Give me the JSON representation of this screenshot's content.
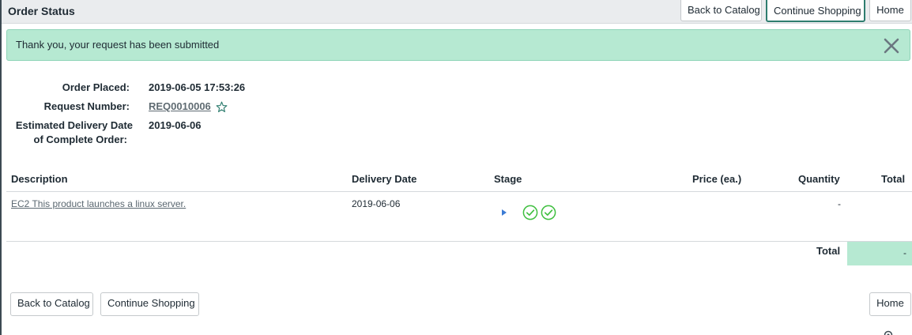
{
  "header": {
    "title": "Order Status",
    "back_to_catalog": "Back to Catalog",
    "continue_shopping": "Continue Shopping",
    "home": "Home"
  },
  "alert": {
    "message": "Thank you, your request has been submitted",
    "close_icon": "close-icon",
    "background": "#b6e9d2"
  },
  "order": {
    "placed_label": "Order Placed:",
    "placed_value": "2019-06-05 17:53:26",
    "request_label": "Request Number:",
    "request_value": "REQ0010006",
    "estimated_label_line1": "Estimated Delivery Date",
    "estimated_label_line2": "of Complete Order:",
    "estimated_value": "2019-06-06"
  },
  "table": {
    "columns": {
      "description": "Description",
      "delivery_date": "Delivery Date",
      "stage": "Stage",
      "price": "Price (ea.)",
      "quantity": "Quantity",
      "total": "Total"
    },
    "rows": [
      {
        "description": "EC2 This product launches a linux server.",
        "delivery_date": "2019-06-06",
        "stage_icons": [
          "expand-arrow-icon",
          "check-circle-icon",
          "check-circle-icon"
        ],
        "price": "",
        "quantity": "-",
        "total": ""
      }
    ],
    "total_label": "Total",
    "total_value": "-"
  },
  "footer": {
    "back_to_catalog": "Back to Catalog",
    "continue_shopping": "Continue Shopping",
    "home": "Home"
  },
  "colors": {
    "accent": "#2e7d6f",
    "success_bg": "#b6e9d2",
    "check_green": "#3fbf3f"
  }
}
